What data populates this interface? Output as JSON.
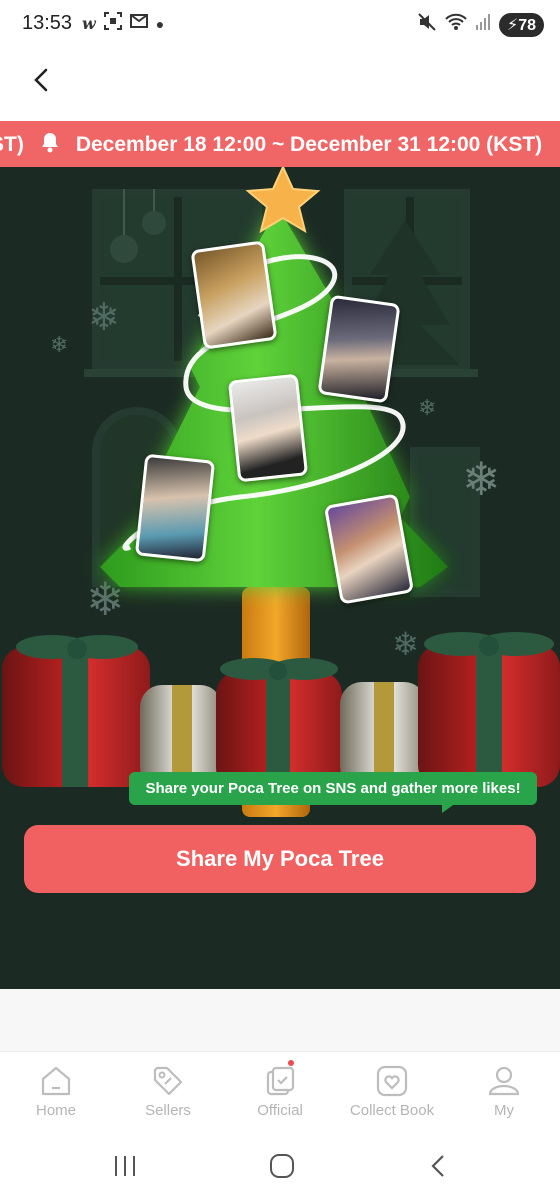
{
  "status_bar": {
    "time": "13:53",
    "battery": "78",
    "left_icons": [
      "w-app-icon",
      "scan-icon",
      "mail-icon",
      "dot-icon"
    ],
    "right_icons": [
      "mute-icon",
      "wifi-icon",
      "signal-icon",
      "battery-icon"
    ]
  },
  "header": {
    "back_icon": "chevron-left-icon"
  },
  "banner": {
    "text": "December 18 12:00 ~ December 31 12:00 (KST)",
    "prefix": "ST)",
    "icon": "bell-icon"
  },
  "tooltip": {
    "text": "Share your Poca Tree on SNS and gather more likes!"
  },
  "share_button": {
    "label": "Share My Poca Tree"
  },
  "bottom_nav": {
    "items": [
      {
        "label": "Home",
        "icon": "home-icon"
      },
      {
        "label": "Sellers",
        "icon": "tag-icon"
      },
      {
        "label": "Official",
        "icon": "official-icon",
        "has_dot": true
      },
      {
        "label": "Collect Book",
        "icon": "heart-book-icon"
      },
      {
        "label": "My",
        "icon": "person-icon"
      }
    ]
  },
  "colors": {
    "accent": "#f06565",
    "tooltip": "#2aa44b",
    "scene_bg": "#1c2a24",
    "nav_inactive": "#b5b5b5"
  }
}
